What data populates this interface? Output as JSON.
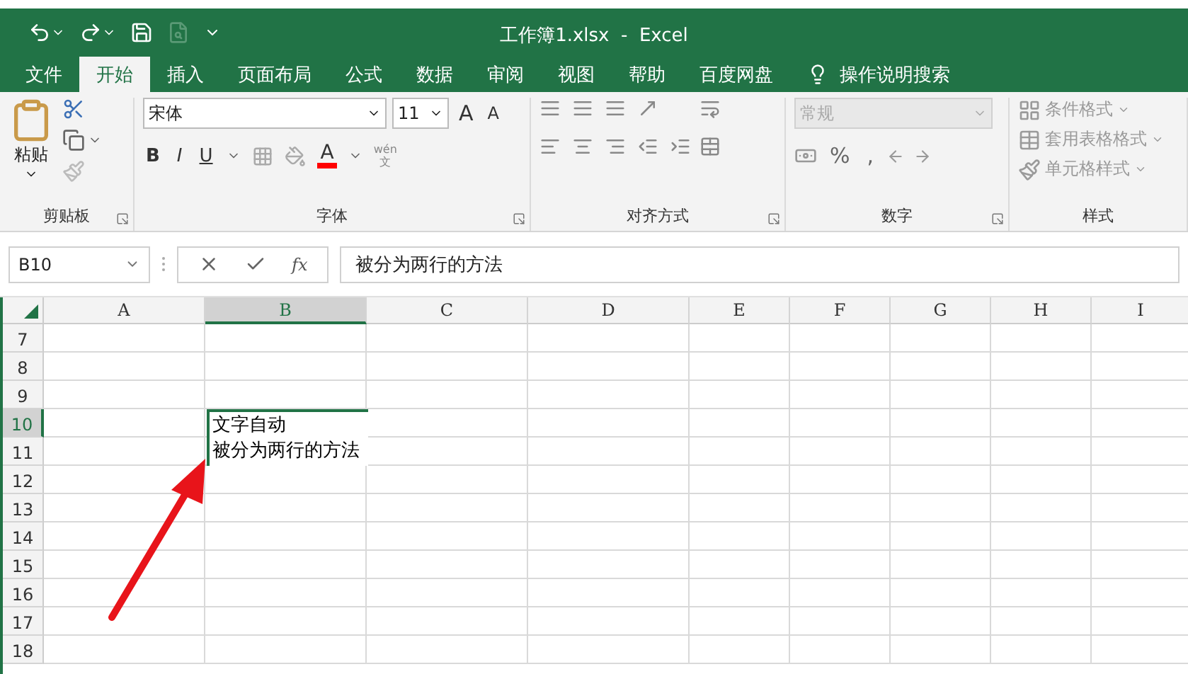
{
  "window": {
    "title": "工作簿1.xlsx  -  Excel"
  },
  "tabs": [
    {
      "label": "文件",
      "selected": false
    },
    {
      "label": "开始",
      "selected": true
    },
    {
      "label": "插入",
      "selected": false
    },
    {
      "label": "页面布局",
      "selected": false
    },
    {
      "label": "公式",
      "selected": false
    },
    {
      "label": "数据",
      "selected": false
    },
    {
      "label": "审阅",
      "selected": false
    },
    {
      "label": "视图",
      "selected": false
    },
    {
      "label": "帮助",
      "selected": false
    },
    {
      "label": "百度网盘",
      "selected": false
    }
  ],
  "search": {
    "placeholder": "操作说明搜索"
  },
  "ribbon": {
    "clipboard": {
      "paste_label": "粘贴",
      "group_label": "剪贴板"
    },
    "font": {
      "font_name": "宋体",
      "font_size": "11",
      "grow_label": "A",
      "shrink_label": "A",
      "style_buttons": [
        {
          "kind": "bold",
          "label": "B"
        },
        {
          "kind": "italic",
          "label": "I"
        },
        {
          "kind": "underline",
          "label": "U"
        }
      ],
      "font_color_label": "A",
      "phonetic_top": "wén",
      "phonetic_bottom": "文",
      "group_label": "字体"
    },
    "alignment": {
      "group_label": "对齐方式"
    },
    "number": {
      "format": "常规",
      "format_disabled": true,
      "percent_label": "%",
      "comma_label": ",",
      "group_label": "数字"
    },
    "styles": {
      "items": [
        {
          "kind": "conditional",
          "label": "条件格式",
          "disabled": true
        },
        {
          "kind": "table",
          "label": "套用表格格式",
          "disabled": true
        },
        {
          "kind": "cell",
          "label": "单元格样式",
          "disabled": true
        }
      ],
      "group_label": "样式"
    }
  },
  "formula_bar": {
    "name_box": "B10",
    "function_label": "fx",
    "value": "被分为两行的方法"
  },
  "sheet": {
    "columns": [
      {
        "label": "A",
        "selected": false
      },
      {
        "label": "B",
        "selected": true
      },
      {
        "label": "C",
        "selected": false
      },
      {
        "label": "D",
        "selected": false
      },
      {
        "label": "E",
        "selected": false
      },
      {
        "label": "F",
        "selected": false
      },
      {
        "label": "G",
        "selected": false
      },
      {
        "label": "H",
        "selected": false
      },
      {
        "label": "I",
        "selected": false
      }
    ],
    "rows": [
      {
        "label": "7",
        "selected": false
      },
      {
        "label": "8",
        "selected": false
      },
      {
        "label": "9",
        "selected": false
      },
      {
        "label": "10",
        "selected": true
      },
      {
        "label": "11",
        "selected": false
      },
      {
        "label": "12",
        "selected": false
      },
      {
        "label": "13",
        "selected": false
      },
      {
        "label": "14",
        "selected": false
      },
      {
        "label": "15",
        "selected": false
      },
      {
        "label": "16",
        "selected": false
      },
      {
        "label": "17",
        "selected": false
      },
      {
        "label": "18",
        "selected": false
      }
    ],
    "active_cell": {
      "lines": [
        "文字自动",
        "被分为两行的方法"
      ]
    }
  }
}
